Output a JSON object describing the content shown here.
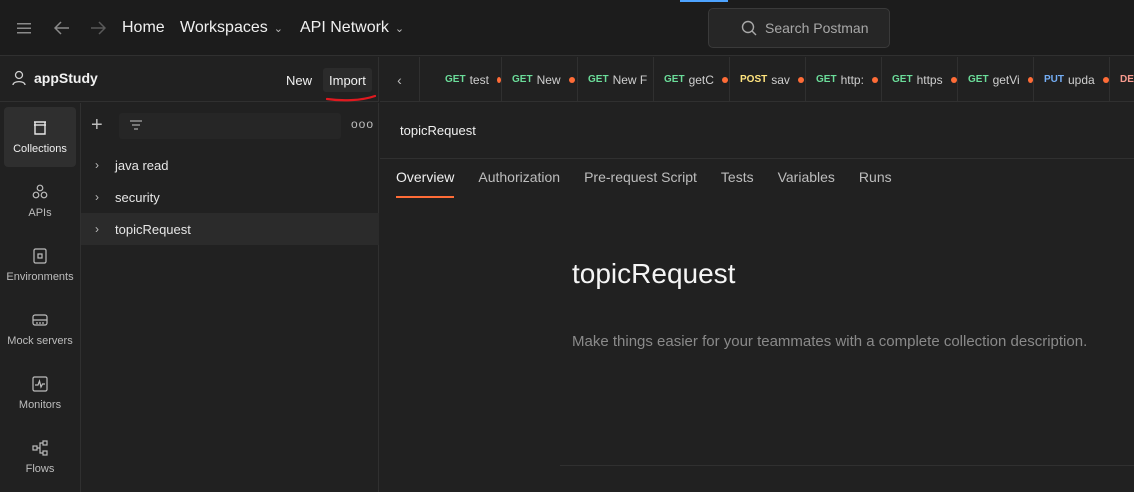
{
  "topbar": {
    "home": "Home",
    "workspaces": "Workspaces",
    "api_network": "API Network",
    "search_placeholder": "Search Postman"
  },
  "workspace": {
    "name": "appStudy",
    "new_label": "New",
    "import_label": "Import"
  },
  "rail": [
    {
      "label": "Collections",
      "icon": "collections-icon"
    },
    {
      "label": "APIs",
      "icon": "apis-icon"
    },
    {
      "label": "Environments",
      "icon": "environments-icon"
    },
    {
      "label": "Mock servers",
      "icon": "mock-servers-icon"
    },
    {
      "label": "Monitors",
      "icon": "monitors-icon"
    },
    {
      "label": "Flows",
      "icon": "flows-icon"
    }
  ],
  "collections": [
    {
      "name": "java read"
    },
    {
      "name": "security"
    },
    {
      "name": "topicRequest"
    }
  ],
  "request_tabs": [
    {
      "method": "GET",
      "name": "test"
    },
    {
      "method": "GET",
      "name": "New"
    },
    {
      "method": "GET",
      "name": "New F"
    },
    {
      "method": "GET",
      "name": "getC"
    },
    {
      "method": "POST",
      "name": "sav"
    },
    {
      "method": "GET",
      "name": "http:"
    },
    {
      "method": "GET",
      "name": "https"
    },
    {
      "method": "GET",
      "name": "getVi"
    },
    {
      "method": "PUT",
      "name": "upda"
    },
    {
      "method": "DEL",
      "name": ""
    }
  ],
  "method_colors": {
    "GET": "#6bdd9a",
    "POST": "#ffe47e",
    "PUT": "#74aef6",
    "DEL": "#f79a8e"
  },
  "main": {
    "breadcrumb": "topicRequest",
    "subtabs": [
      "Overview",
      "Authorization",
      "Pre-request Script",
      "Tests",
      "Variables",
      "Runs"
    ],
    "title": "topicRequest",
    "description": "Make things easier for your teammates with a complete collection description."
  }
}
